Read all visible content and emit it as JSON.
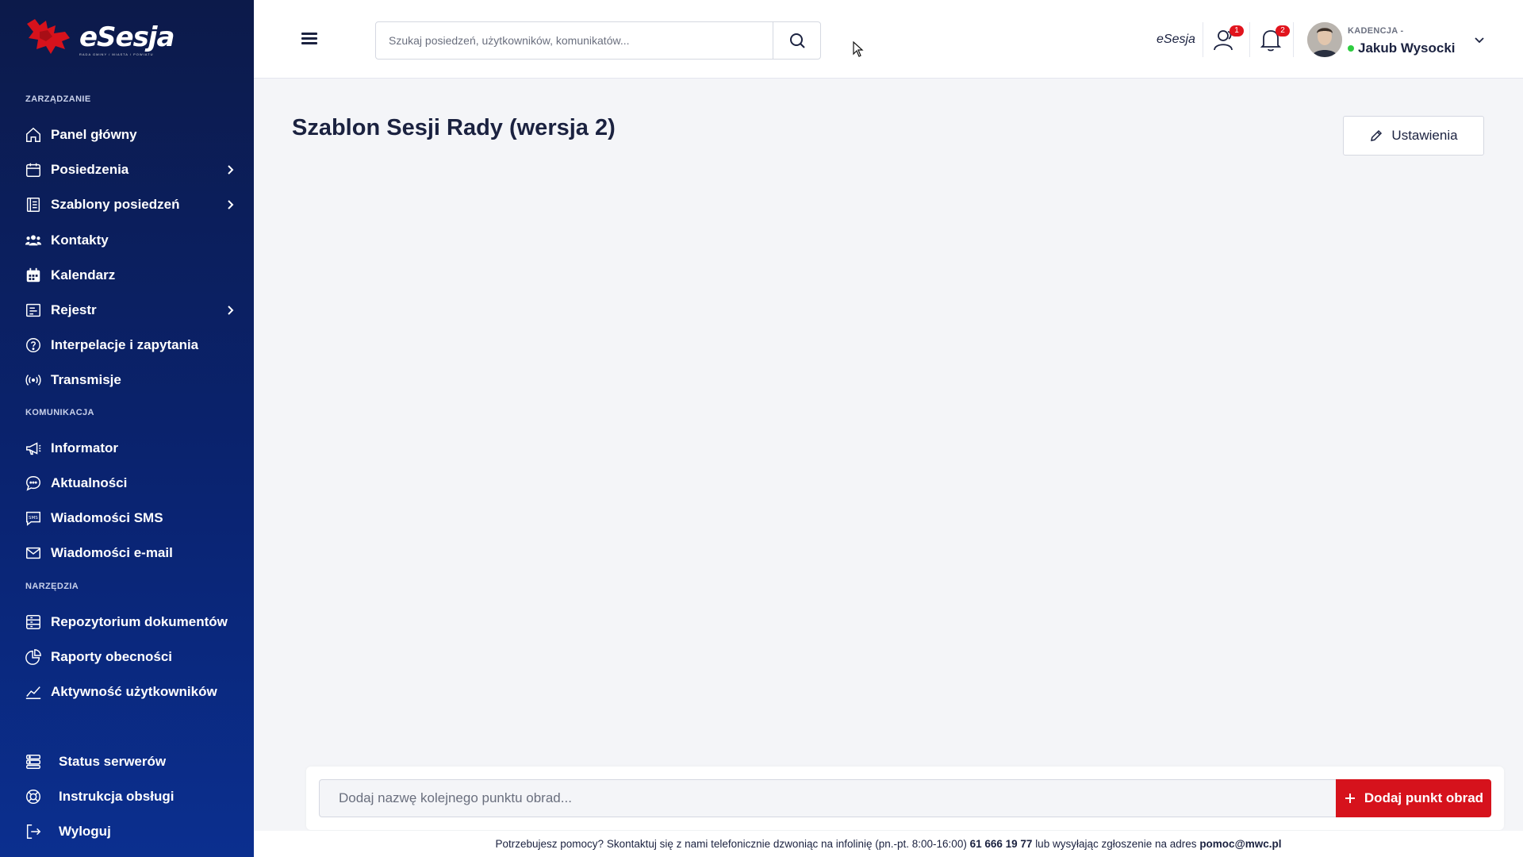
{
  "app": {
    "brand": "eSesja",
    "brand_sub": "RADA GMINY / MIASTA / POWIATU"
  },
  "sidebar": {
    "sections": [
      {
        "title": "ZARZĄDZANIE"
      },
      {
        "title": "KOMUNIKACJA"
      },
      {
        "title": "NARZĘDZIA"
      }
    ],
    "items": [
      {
        "label": "Panel główny",
        "icon": "home-icon"
      },
      {
        "label": "Posiedzenia",
        "icon": "calendar-icon",
        "expandable": true
      },
      {
        "label": "Szablony posiedzeń",
        "icon": "template-icon",
        "expandable": true
      },
      {
        "label": "Kontakty",
        "icon": "contacts-icon"
      },
      {
        "label": "Kalendarz",
        "icon": "calendar-grid-icon"
      },
      {
        "label": "Rejestr",
        "icon": "register-icon",
        "expandable": true
      },
      {
        "label": "Interpelacje i zapytania",
        "icon": "question-icon"
      },
      {
        "label": "Transmisje",
        "icon": "broadcast-icon"
      },
      {
        "label": "Informator",
        "icon": "megaphone-icon"
      },
      {
        "label": "Aktualności",
        "icon": "chat-bubble-icon"
      },
      {
        "label": "Wiadomości SMS",
        "icon": "sms-icon"
      },
      {
        "label": "Wiadomości e-mail",
        "icon": "mail-icon"
      },
      {
        "label": "Repozytorium dokumentów",
        "icon": "documents-icon"
      },
      {
        "label": "Raporty obecności",
        "icon": "pie-chart-icon"
      },
      {
        "label": "Aktywność użytkowników",
        "icon": "activity-chart-icon"
      }
    ],
    "bottom": [
      {
        "label": "Status serwerów",
        "icon": "server-icon"
      },
      {
        "label": "Instrukcja obsługi",
        "icon": "lifebuoy-icon"
      },
      {
        "label": "Wyloguj",
        "icon": "logout-icon"
      }
    ]
  },
  "topbar": {
    "search_placeholder": "Szukaj posiedzeń, użytkowników, komunikatów...",
    "brand_small": "eSesja",
    "users_badge": "1",
    "notifications_badge": "2",
    "kadencja_label": "KADENCJA -",
    "user_name": "Jakub Wysocki"
  },
  "main": {
    "title": "Szablon Sesji Rady (wersja 2)",
    "settings_label": "Ustawienia",
    "agenda_placeholder": "Dodaj nazwę kolejnego punktu obrad...",
    "add_agenda_label": "Dodaj punkt obrad"
  },
  "footer": {
    "text_before": "Potrzebujesz pomocy? Skontaktuj się z nami telefonicznie dzwoniąc na infolinię (pn.-pt. 8:00-16:00)",
    "phone": "61 666 19 77",
    "text_middle": "lub wysyłając zgłoszenie na adres",
    "email": "pomoc@mwc.pl"
  },
  "colors": {
    "sidebar_top": "#0c1a4a",
    "sidebar_bottom": "#0b2f8f",
    "accent_red": "#d6121c",
    "online": "#2ecc40"
  }
}
